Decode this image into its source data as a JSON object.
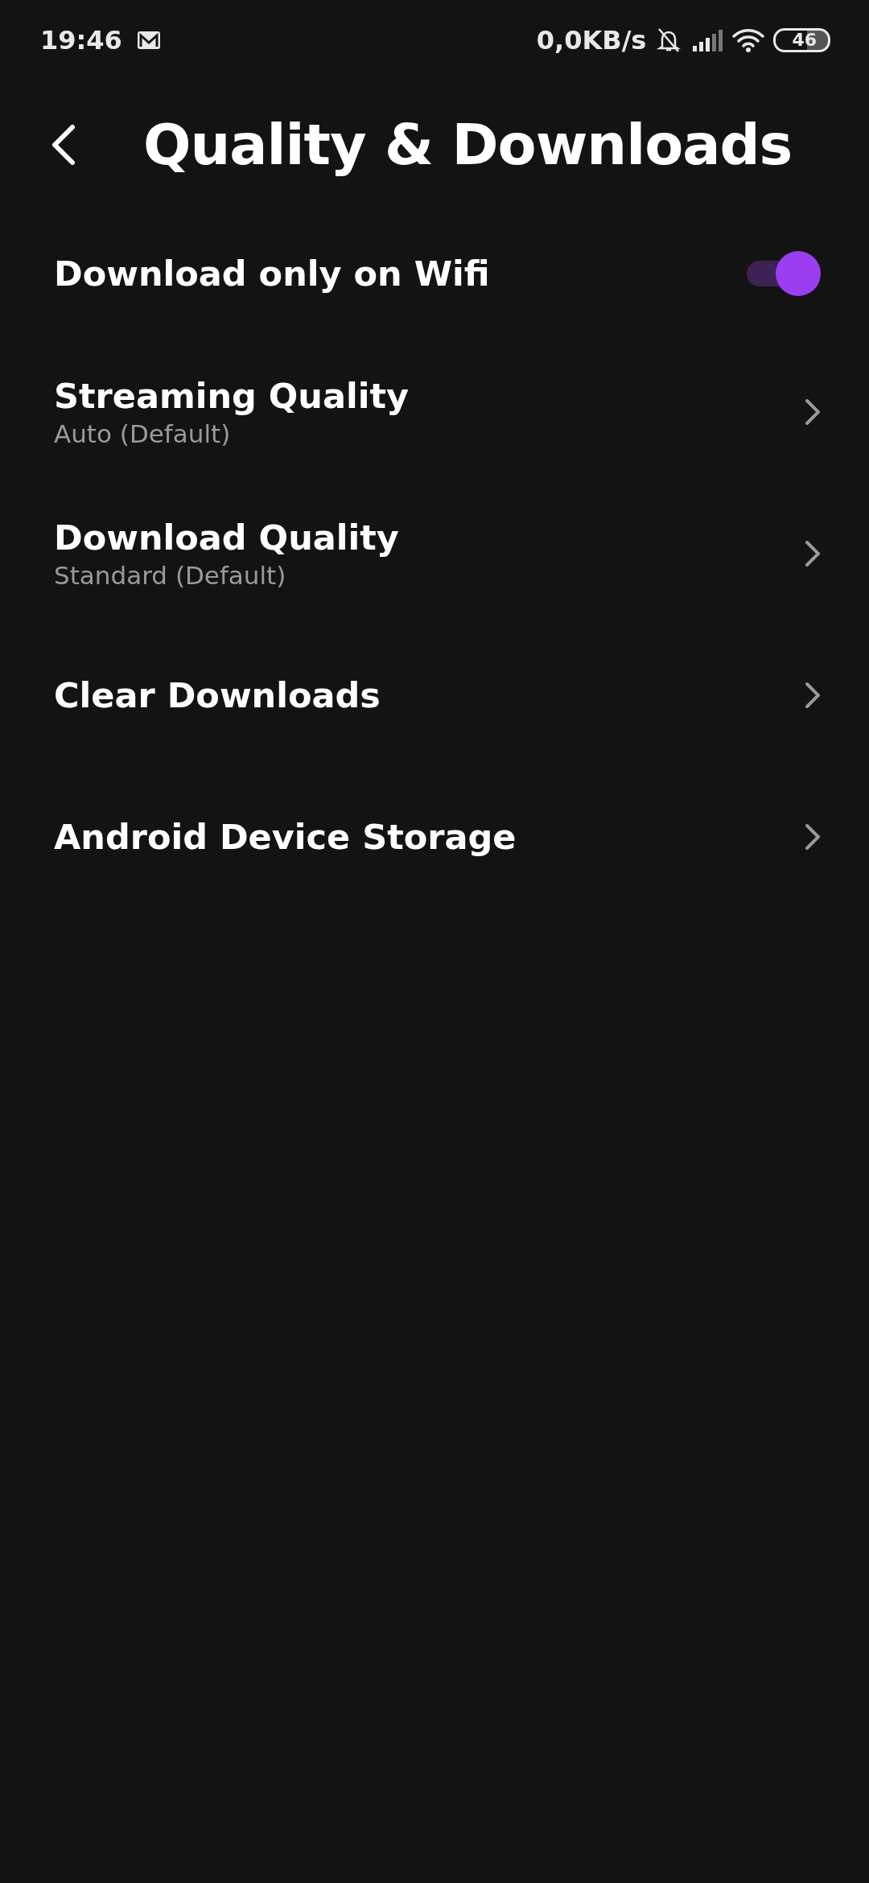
{
  "status_bar": {
    "time": "19:46",
    "net_speed": "0,0KB/s",
    "battery": "46"
  },
  "header": {
    "title": "Quality & Downloads"
  },
  "settings": [
    {
      "kind": "toggle",
      "label": "Download only on Wifi",
      "on": true
    },
    {
      "kind": "link",
      "label": "Streaming Quality",
      "value": "Auto (Default)"
    },
    {
      "kind": "link",
      "label": "Download Quality",
      "value": "Standard (Default)"
    },
    {
      "kind": "link",
      "label": "Clear Downloads"
    },
    {
      "kind": "link",
      "label": "Android Device Storage"
    }
  ]
}
